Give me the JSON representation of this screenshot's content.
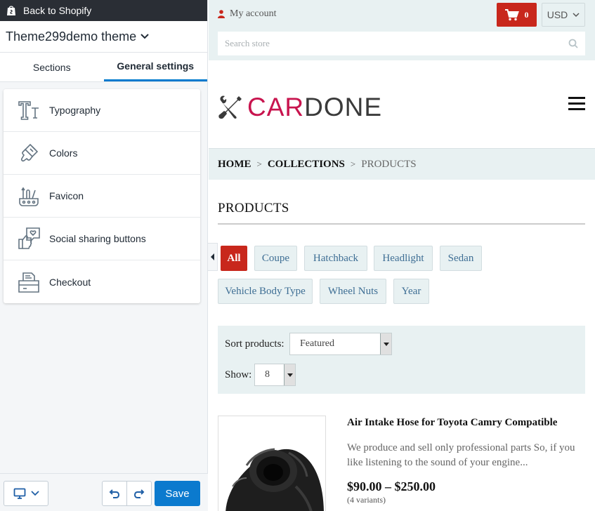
{
  "editor": {
    "back_label": "Back to Shopify",
    "theme_name": "Theme299demo theme",
    "tabs": [
      {
        "label": "Sections"
      },
      {
        "label": "General settings"
      }
    ],
    "settings": [
      {
        "label": "Typography",
        "icon": "typography-icon"
      },
      {
        "label": "Colors",
        "icon": "paintbrush-icon"
      },
      {
        "label": "Favicon",
        "icon": "favicon-icon"
      },
      {
        "label": "Social sharing buttons",
        "icon": "social-share-icon"
      },
      {
        "label": "Checkout",
        "icon": "checkout-icon"
      }
    ],
    "save_label": "Save",
    "accent": "#0b7ace"
  },
  "store": {
    "account_label": "My account",
    "cart_count": "0",
    "currency": "USD",
    "search_placeholder": "Search store",
    "logo": {
      "part1": "CAR",
      "part2": "DONE"
    },
    "breadcrumbs": {
      "home": "HOME",
      "collections": "COLLECTIONS",
      "current": "PRODUCTS"
    },
    "page_title": "PRODUCTS",
    "tags": [
      "All",
      "Coupe",
      "Hatchback",
      "Headlight",
      "Sedan",
      "Vehicle Body Type",
      "Wheel Nuts",
      "Year"
    ],
    "sort": {
      "label": "Sort products:",
      "value": "Featured"
    },
    "show": {
      "label": "Show:",
      "value": "8"
    },
    "product": {
      "name": "Air Intake Hose for Toyota Camry Compatible",
      "description": "We produce and sell only professional parts So, if you like listening to the sound of your engine...",
      "price": "$90.00 – $250.00",
      "variants": "(4 variants)"
    },
    "brand_color": "#c8271c"
  }
}
